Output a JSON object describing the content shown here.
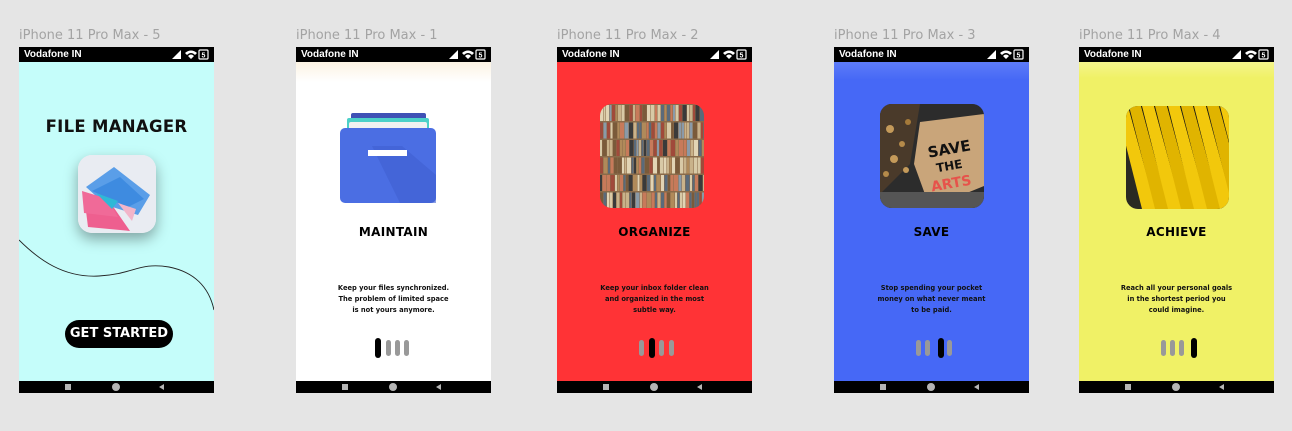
{
  "frames": [
    {
      "label": "iPhone 11 Pro Max - 5"
    },
    {
      "label": "iPhone 11 Pro Max - 1"
    },
    {
      "label": "iPhone 11 Pro Max - 2"
    },
    {
      "label": "iPhone 11 Pro Max - 3"
    },
    {
      "label": "iPhone 11 Pro Max - 4"
    }
  ],
  "status": {
    "carrier": "Vodafone IN",
    "battery": "5"
  },
  "splash": {
    "title": "FILE MANAGER",
    "cta_label": "GET STARTED"
  },
  "onboarding": [
    {
      "title": "MAINTAIN",
      "line1": "Keep your files synchronized.",
      "line2": "The problem of limited space",
      "line3": "is not yours anymore.",
      "active_dot": 1
    },
    {
      "title": "ORGANIZE",
      "line1": "Keep your inbox folder clean",
      "line2": "and organized in the most",
      "line3": "subtle way.",
      "active_dot": 2
    },
    {
      "title": "SAVE",
      "line1": "Stop spending your pocket",
      "line2": "money on what never meant",
      "line3": "to be paid.",
      "active_dot": 3
    },
    {
      "title": "ACHIEVE",
      "line1": "Reach all your personal goals",
      "line2": "in the shortest period you",
      "line3": "could imagine.",
      "active_dot": 4
    }
  ],
  "colors": {
    "splash_bg": "#c5fdfa",
    "maintain_bg": "#ffffff",
    "organize_bg": "#ff3336",
    "save_bg": "#4668f6",
    "achieve_bg": "#f0f166"
  },
  "sign_text": "SAVE THE ARTS"
}
